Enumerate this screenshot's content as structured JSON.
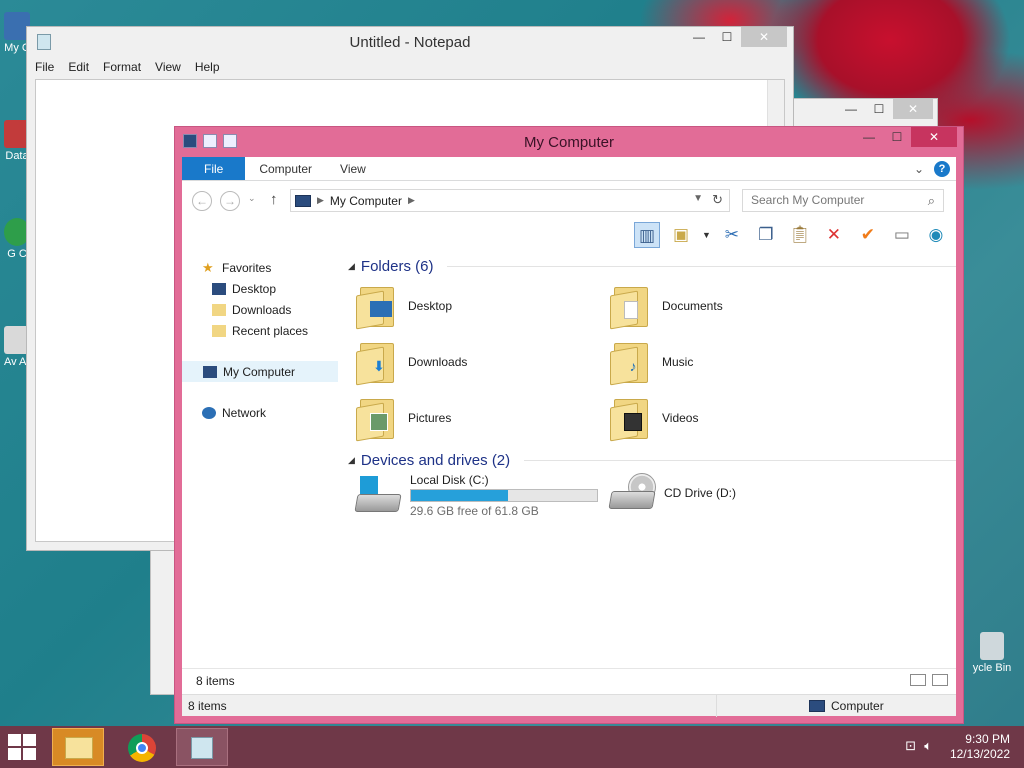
{
  "desktop": {
    "icons": [
      {
        "label": "My C"
      },
      {
        "label": "Data"
      },
      {
        "label": "G C"
      },
      {
        "label": "Av Ar"
      },
      {
        "label": "ycle Bin"
      }
    ]
  },
  "notepad": {
    "title": "Untitled - Notepad",
    "menu": [
      "File",
      "Edit",
      "Format",
      "View",
      "Help"
    ],
    "min": "—",
    "max": "☐",
    "close": "✕"
  },
  "explorer": {
    "title": "My Computer",
    "tabs": {
      "file": "File",
      "computer": "Computer",
      "view": "View"
    },
    "address": {
      "root": "My Computer"
    },
    "search_placeholder": "Search My Computer",
    "nav": {
      "favorites": "Favorites",
      "desktop": "Desktop",
      "downloads": "Downloads",
      "recent": "Recent places",
      "my_computer": "My Computer",
      "network": "Network"
    },
    "folders_header": "Folders (6)",
    "folders": [
      "Desktop",
      "Documents",
      "Downloads",
      "Music",
      "Pictures",
      "Videos"
    ],
    "devices_header": "Devices and drives (2)",
    "drives": {
      "c_name": "Local Disk (C:)",
      "c_free": "29.6 GB free of 61.8 GB",
      "c_used_fraction": 0.52,
      "d_name": "CD Drive (D:)"
    },
    "status_count": "8 items",
    "outer_count": "8 items",
    "outer_location": "Computer"
  },
  "taskbar": {
    "time": "9:30 PM",
    "date": "12/13/2022"
  },
  "colors": {
    "explorer_frame": "#e26c97",
    "file_tab": "#1979ca",
    "taskbar": "#6f3848",
    "drive_bar": "#26a0da"
  }
}
